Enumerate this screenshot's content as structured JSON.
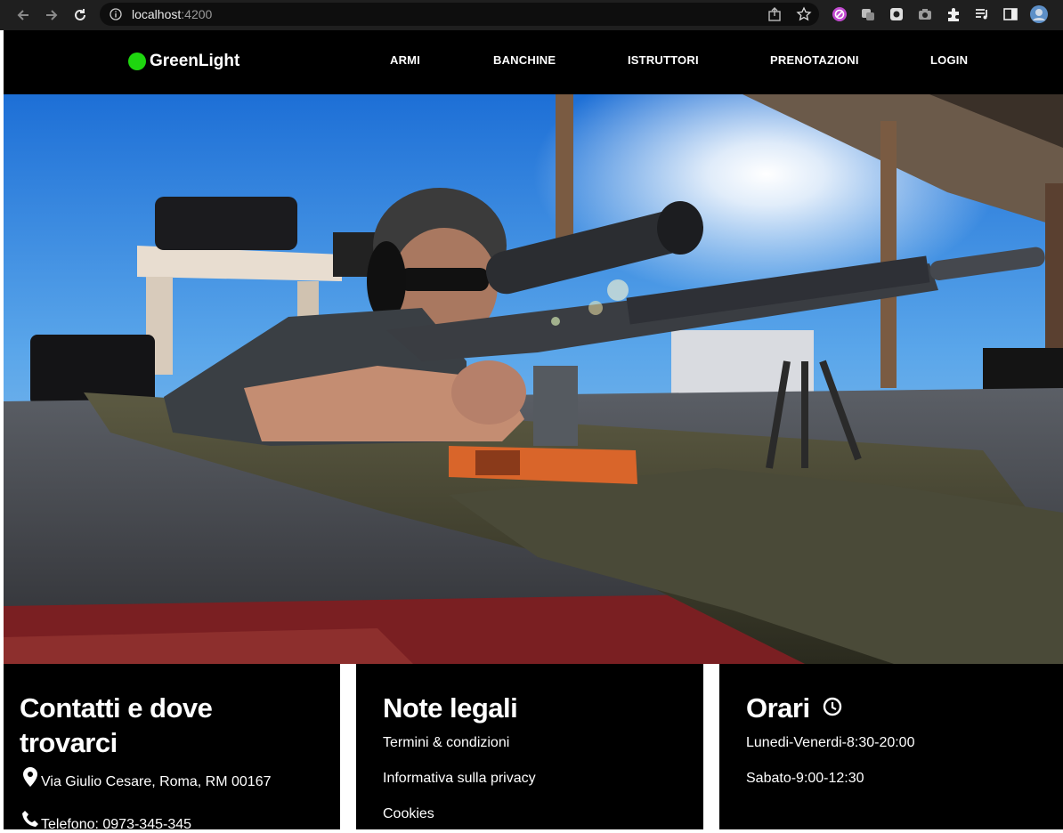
{
  "browser": {
    "url_host": "localhost",
    "url_port": ":4200"
  },
  "site": {
    "brand": "GreenLight",
    "brand_color": "#1ed60f",
    "nav": [
      "ARMI",
      "BANCHINE",
      "ISTRUTTORI",
      "PRENOTAZIONI",
      "LOGIN"
    ]
  },
  "hero": {
    "image": "shooter-prone-with-scoped-rifle-at-range"
  },
  "footer": {
    "contacts": {
      "title_line1": "Contatti e dove",
      "title_line2": "trovarci",
      "address_icon": "map-pin-icon",
      "address": "Via Giulio Cesare, Roma, RM 00167",
      "phone_icon": "phone-icon",
      "phone": "Telefono: 0973-345-345"
    },
    "legal": {
      "title": "Note legali",
      "links": [
        "Termini & condizioni",
        "Informativa sulla privacy",
        "Cookies"
      ]
    },
    "hours": {
      "title": "Orari",
      "clock_icon": "clock-icon",
      "weekdays": "Lunedi-Venerdi-8:30-20:00",
      "saturday": "Sabato-9:00-12:30"
    }
  }
}
